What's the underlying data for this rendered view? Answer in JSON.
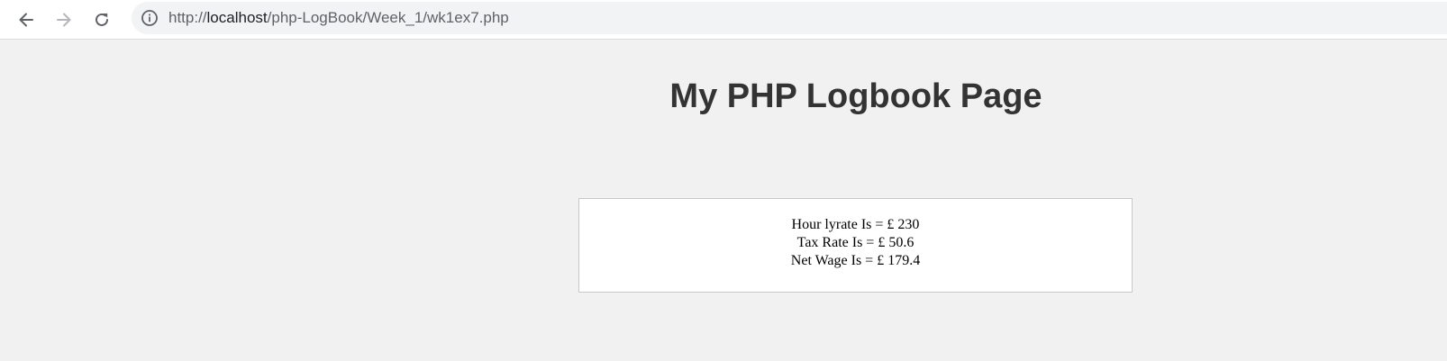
{
  "browser": {
    "url_scheme": "http://",
    "url_host": "localhost",
    "url_path": "/php-LogBook/Week_1/wk1ex7.php"
  },
  "page": {
    "title": "My PHP Logbook Page",
    "lines": [
      "Hour lyrate Is = £ 230",
      "Tax Rate Is = £ 50.6",
      "Net Wage Is = £ 179.4"
    ]
  }
}
